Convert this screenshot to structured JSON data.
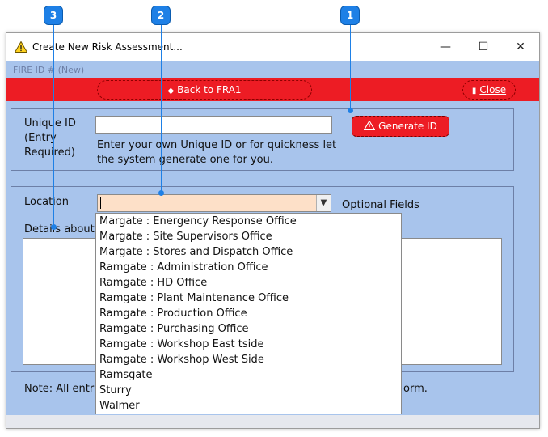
{
  "window": {
    "title": "Create New Risk Assessment...",
    "minimize_glyph": "—",
    "maximize_glyph": "☐",
    "close_glyph": "✕"
  },
  "fire_id_label": "FIRE ID # (New)",
  "toolbar": {
    "back_label": "Back to FRA1",
    "close_label": "Close"
  },
  "unique_id": {
    "label": "Unique ID\n(Entry\nRequired)",
    "value": "",
    "help": "Enter your own Unique ID or for quickness let the system generate one for you.",
    "generate_label": "Generate ID"
  },
  "location": {
    "label": "Location",
    "value": "",
    "optional_label": "Optional Fields",
    "details_label": "Details about R",
    "options": [
      "Margate : Energency Response Office",
      "Margate : Site Supervisors Office",
      "Margate : Stores and Dispatch Office",
      "Ramgate : Administration Office",
      "Ramgate : HD Office",
      "Ramgate : Plant Maintenance Office",
      "Ramgate : Production Office",
      "Ramgate : Purchasing Office",
      "Ramgate : Workshop East tside",
      "Ramgate : Workshop West Side",
      "Ramsgate",
      "Sturry",
      "Walmer"
    ]
  },
  "note": {
    "left": "Note: All entri",
    "right": "orm."
  },
  "callouts": [
    "1",
    "2",
    "3"
  ],
  "colors": {
    "accent_red": "#ed1c24",
    "form_bg": "#a8c4ec",
    "callout_blue": "#1e80e6",
    "combo_bg": "#fde0c8"
  }
}
